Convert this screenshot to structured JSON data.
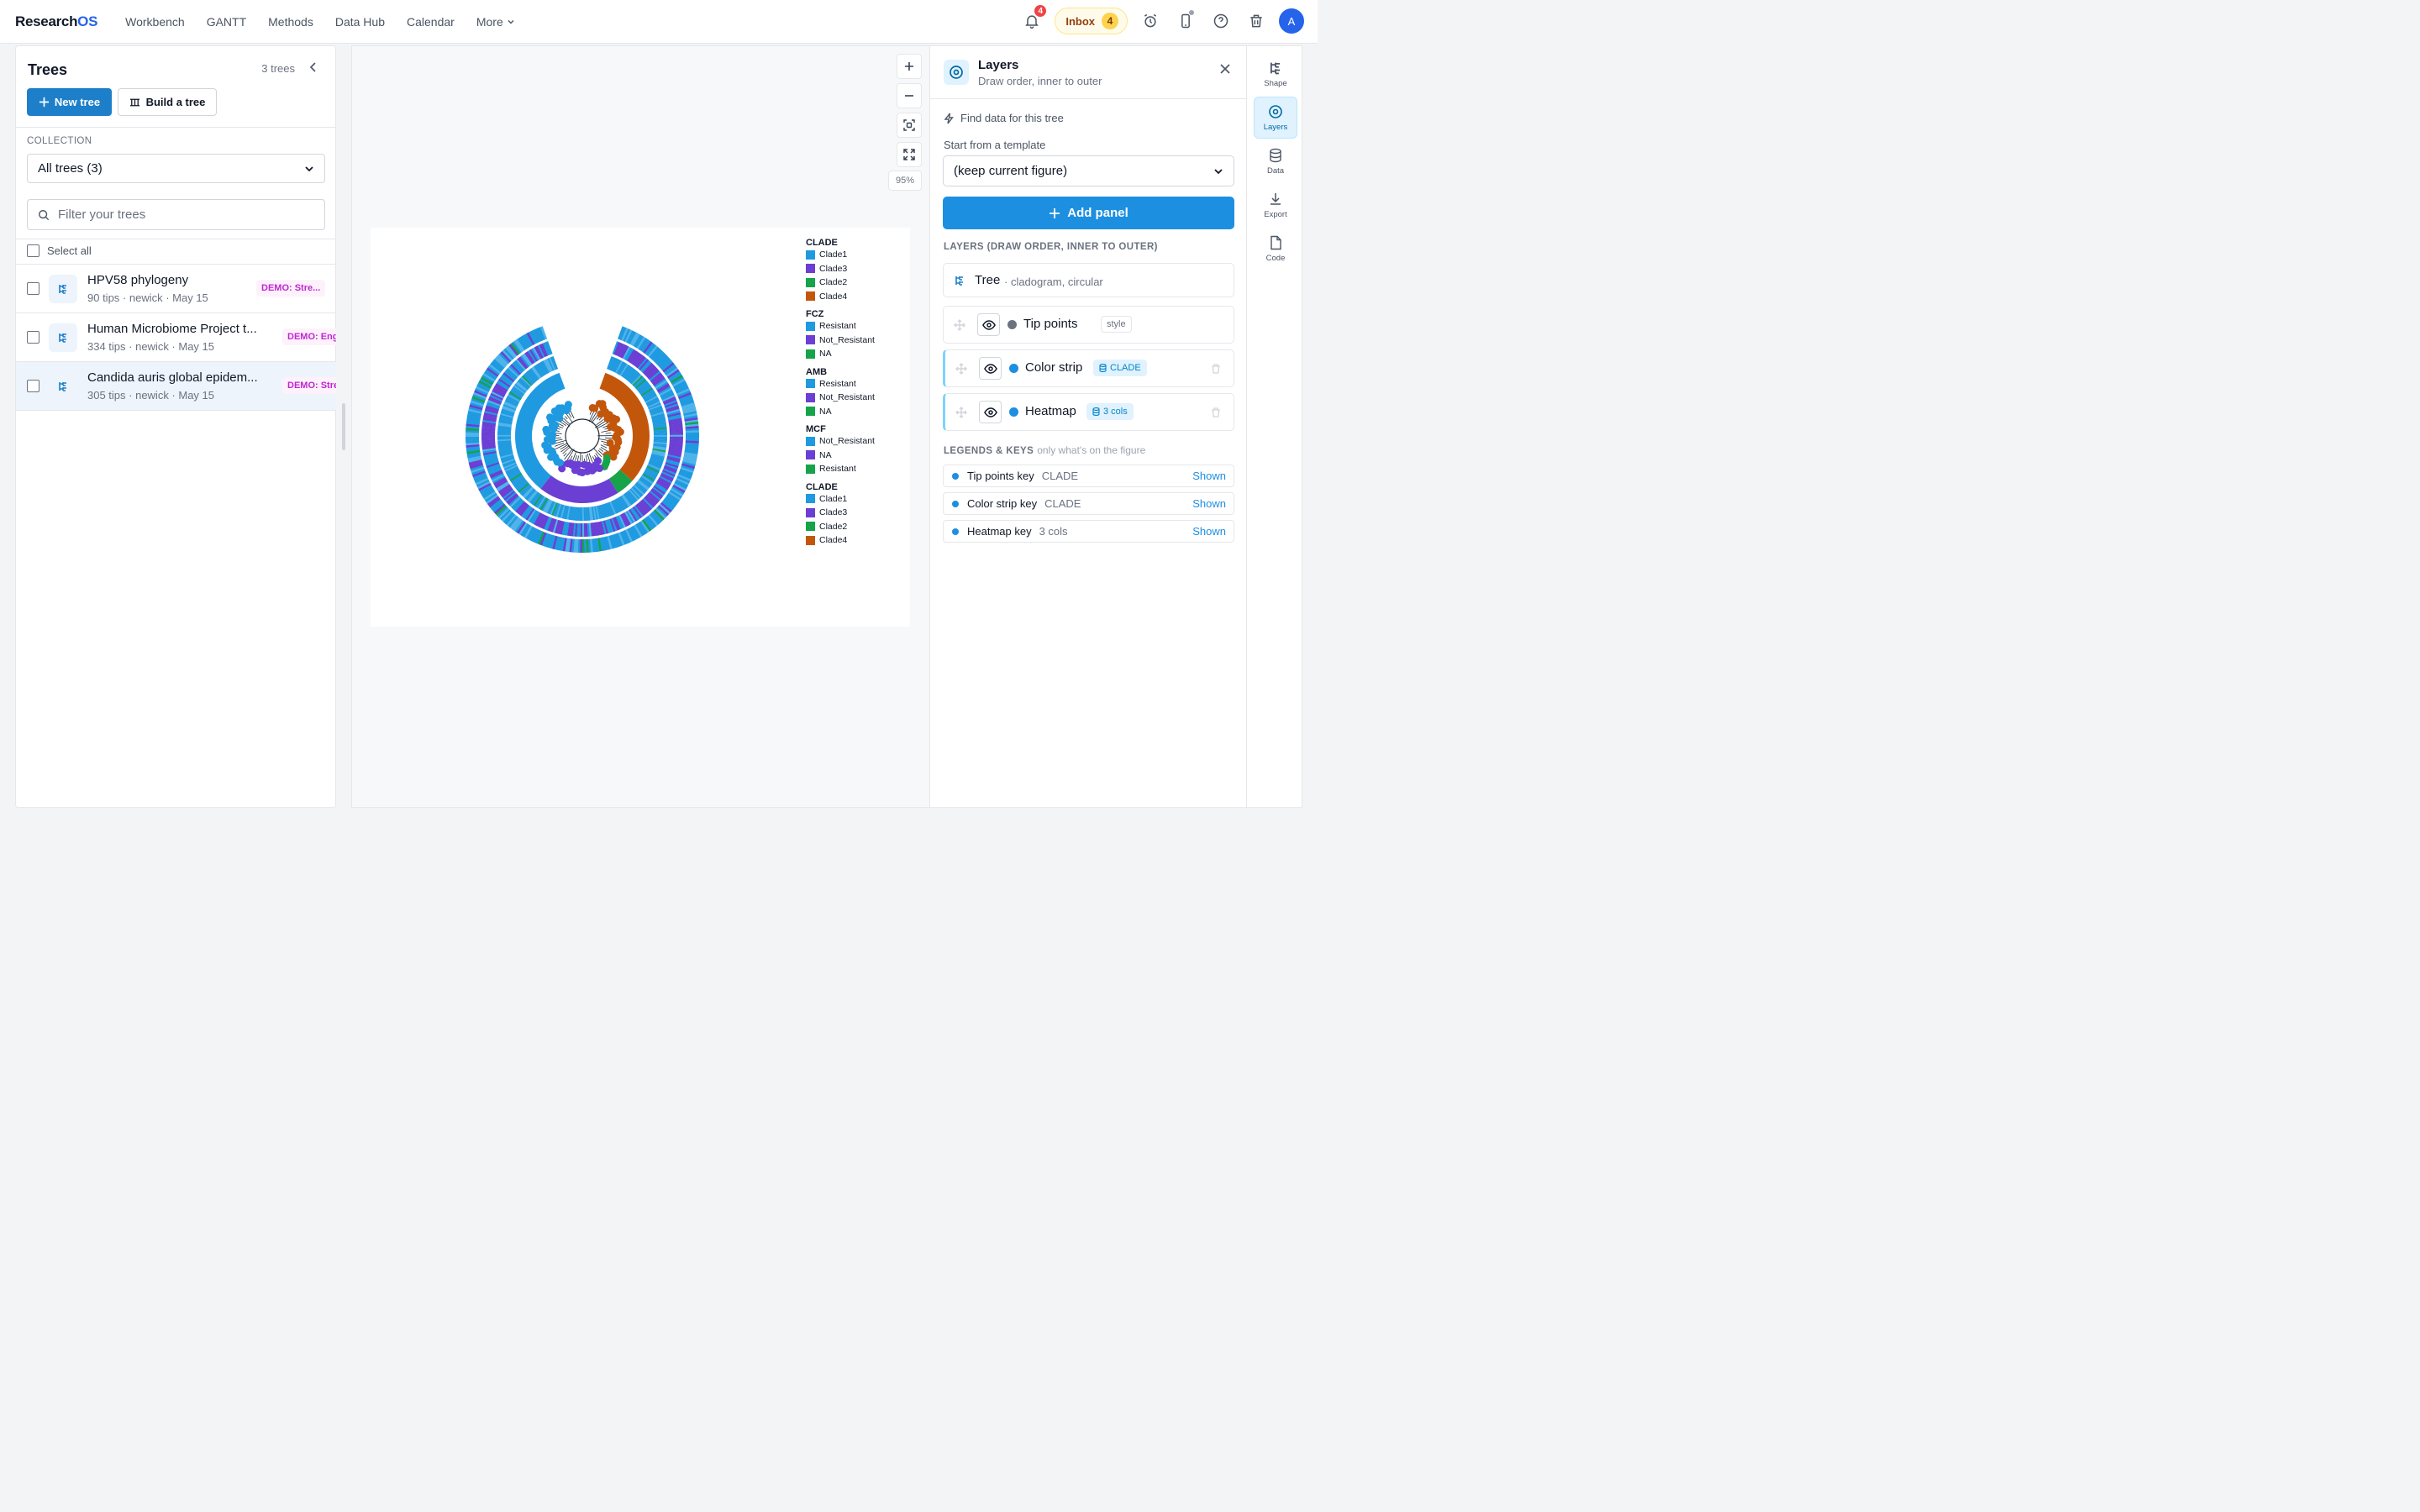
{
  "app": {
    "brand_main": "Research",
    "brand_accent": "OS"
  },
  "nav": [
    "Workbench",
    "GANTT",
    "Methods",
    "Data Hub",
    "Calendar",
    "More"
  ],
  "topbar": {
    "notif_count": "4",
    "inbox_label": "Inbox",
    "inbox_count": "4",
    "avatar": "A"
  },
  "left": {
    "title": "Trees",
    "count": "3 trees",
    "new_tree": "New tree",
    "build_tree": "Build a tree",
    "collection_label": "COLLECTION",
    "collection_value": "All trees (3)",
    "filter_placeholder": "Filter your trees",
    "select_all": "Select all",
    "trees": [
      {
        "name": "HPV58 phylogeny",
        "meta": "90 tips · newick · May 15",
        "demo": "DEMO: Stre..."
      },
      {
        "name": "Human Microbiome Project t...",
        "meta": "334 tips · newick · May 15",
        "demo": "DEMO: Eng"
      },
      {
        "name": "Candida auris global epidem...",
        "meta": "305 tips · newick · May 15",
        "demo": "DEMO: Stre"
      }
    ]
  },
  "canvas": {
    "zoom": "95%"
  },
  "figure": {
    "legend": [
      {
        "title": "CLADE",
        "items": [
          {
            "label": "Clade1",
            "color": "#1f9ae0"
          },
          {
            "label": "Clade3",
            "color": "#6b3fd4"
          },
          {
            "label": "Clade2",
            "color": "#16a34a"
          },
          {
            "label": "Clade4",
            "color": "#c2570c"
          }
        ]
      },
      {
        "title": "FCZ",
        "items": [
          {
            "label": "Resistant",
            "color": "#1f9ae0"
          },
          {
            "label": "Not_Resistant",
            "color": "#6b3fd4"
          },
          {
            "label": "NA",
            "color": "#16a34a"
          }
        ]
      },
      {
        "title": "AMB",
        "items": [
          {
            "label": "Resistant",
            "color": "#1f9ae0"
          },
          {
            "label": "Not_Resistant",
            "color": "#6b3fd4"
          },
          {
            "label": "NA",
            "color": "#16a34a"
          }
        ]
      },
      {
        "title": "MCF",
        "items": [
          {
            "label": "Not_Resistant",
            "color": "#1f9ae0"
          },
          {
            "label": "NA",
            "color": "#6b3fd4"
          },
          {
            "label": "Resistant",
            "color": "#16a34a"
          }
        ]
      },
      {
        "title": "CLADE",
        "items": [
          {
            "label": "Clade1",
            "color": "#1f9ae0"
          },
          {
            "label": "Clade3",
            "color": "#6b3fd4"
          },
          {
            "label": "Clade2",
            "color": "#16a34a"
          },
          {
            "label": "Clade4",
            "color": "#c2570c"
          }
        ]
      }
    ]
  },
  "layers_panel": {
    "title": "Layers",
    "subtitle": "Draw order, inner to outer",
    "find_data": "Find data for this tree",
    "template_label": "Start from a template",
    "template_value": "(keep current figure)",
    "add_panel": "Add panel",
    "layers_heading": "LAYERS (DRAW ORDER, INNER TO OUTER)",
    "tree_layer": {
      "name": "Tree",
      "desc": "· cladogram, circular"
    },
    "layers": [
      {
        "name": "Tip points",
        "tag": "style",
        "color": "#6b7280"
      },
      {
        "name": "Color strip",
        "tag": "CLADE",
        "color": "#1d8fe0"
      },
      {
        "name": "Heatmap",
        "tag": "3 cols",
        "color": "#1d8fe0"
      }
    ],
    "legends_heading": "LEGENDS & KEYS",
    "legends_sub": "only what's on the figure",
    "keys": [
      {
        "name": "Tip points key",
        "value": "CLADE",
        "state": "Shown"
      },
      {
        "name": "Color strip key",
        "value": "CLADE",
        "state": "Shown"
      },
      {
        "name": "Heatmap key",
        "value": "3 cols",
        "state": "Shown"
      }
    ]
  },
  "rail": [
    "Shape",
    "Layers",
    "Data",
    "Export",
    "Code"
  ]
}
